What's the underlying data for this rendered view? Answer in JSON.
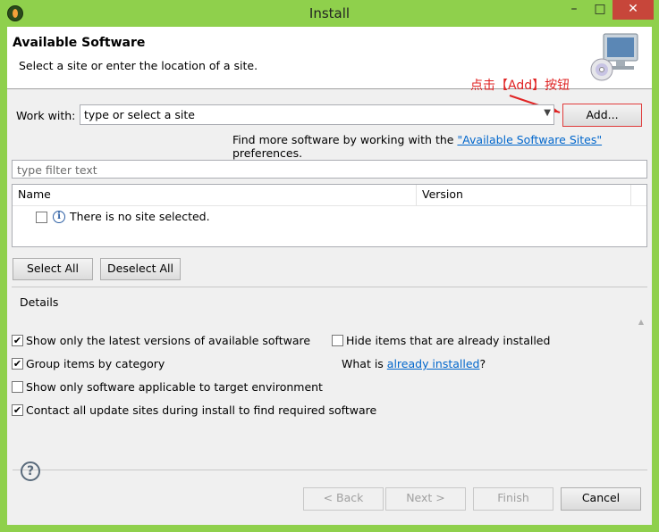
{
  "window": {
    "title": "Install",
    "minimize": "–",
    "maximize": "□",
    "close": "✕"
  },
  "banner": {
    "title": "Available Software",
    "description": "Select a site or enter the location of a site."
  },
  "annotation": "点击【Add】按钮",
  "work_with": {
    "label": "Work with:",
    "value": "type or select a site",
    "add_label": "Add...",
    "find_more_prefix": "Find more software by working with the ",
    "find_more_link": "\"Available Software Sites\"",
    "find_more_suffix": " preferences."
  },
  "filter": {
    "placeholder": "type filter text"
  },
  "table": {
    "columns": [
      "Name",
      "Version"
    ],
    "rows": [
      {
        "name": "There is no site selected.",
        "checked": false
      }
    ]
  },
  "buttons": {
    "select_all": "Select All",
    "deselect_all": "Deselect All"
  },
  "details": {
    "label": "Details"
  },
  "options": {
    "latest_versions": {
      "label": "Show only the latest versions of available software",
      "checked": true
    },
    "hide_installed": {
      "label": "Hide items that are already installed",
      "checked": false
    },
    "group_by_category": {
      "label": "Group items by category",
      "checked": true
    },
    "applicable_only": {
      "label": "Show only software applicable to target environment",
      "checked": false
    },
    "contact_sites": {
      "label": "Contact all update sites during install to find required software",
      "checked": true
    }
  },
  "what_is": {
    "prefix": "What is ",
    "link": "already installed",
    "suffix": "?"
  },
  "footer": {
    "back": "< Back",
    "next": "Next >",
    "finish": "Finish",
    "cancel": "Cancel"
  },
  "colors": {
    "frame": "#8fd04c",
    "close": "#c7463a",
    "link": "#0066cc",
    "annotation": "#e02424"
  },
  "icons": [
    "eclipse-app-icon",
    "monitor-cd-icon",
    "info-icon",
    "help-icon",
    "chevron-down-icon"
  ]
}
